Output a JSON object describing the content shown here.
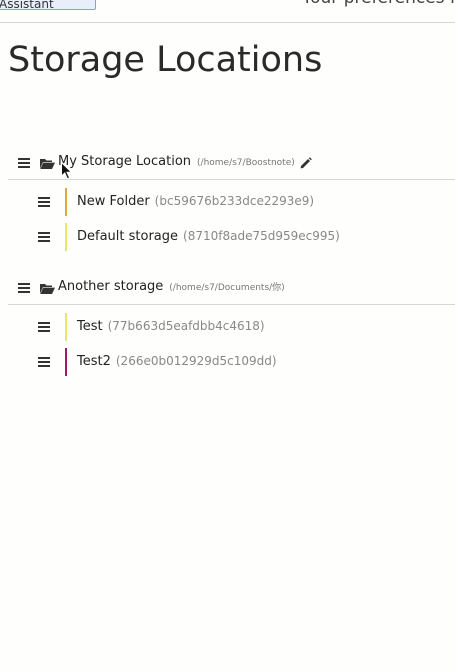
{
  "top_bar": {
    "button_label": "Assistant",
    "preferences_text": "Your preferences fo"
  },
  "page": {
    "title": "Storage Locations"
  },
  "storages": [
    {
      "name": "My Storage Location",
      "path": "(/home/s7/Boostnote)",
      "editable": true,
      "folders": [
        {
          "name": "New Folder",
          "key": "(bc59676b233dce2293e9)",
          "color": "#e0a73c"
        },
        {
          "name": "Default storage",
          "key": "(8710f8ade75d959ec995)",
          "color": "#e6e56a"
        }
      ]
    },
    {
      "name": "Another storage",
      "path": "(/home/s7/Documents/你)",
      "editable": false,
      "folders": [
        {
          "name": "Test",
          "key": "(77b663d5eafdbb4c4618)",
          "color": "#e6e56a"
        },
        {
          "name": "Test2",
          "key": "(266e0b012929d5c109dd)",
          "color": "#a01a6a"
        }
      ]
    }
  ]
}
